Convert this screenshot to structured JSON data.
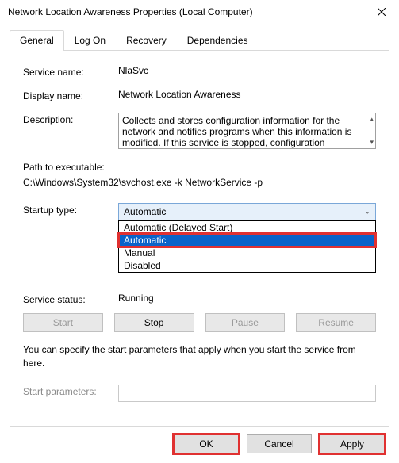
{
  "window": {
    "title": "Network Location Awareness Properties (Local Computer)"
  },
  "tabs": {
    "general": "General",
    "logon": "Log On",
    "recovery": "Recovery",
    "dependencies": "Dependencies"
  },
  "labels": {
    "service_name": "Service name:",
    "display_name": "Display name:",
    "description": "Description:",
    "path_to_exe": "Path to executable:",
    "startup_type": "Startup type:",
    "service_status": "Service status:",
    "start_parameters": "Start parameters:"
  },
  "values": {
    "service_name": "NlaSvc",
    "display_name": "Network Location Awareness",
    "description": "Collects and stores configuration information for the network and notifies programs when this information is modified. If this service is stopped, configuration",
    "path_to_exe": "C:\\Windows\\System32\\svchost.exe -k NetworkService -p",
    "startup_selected": "Automatic",
    "service_status": "Running",
    "hint": "You can specify the start parameters that apply when you start the service from here.",
    "start_parameters": ""
  },
  "startup_options": {
    "delayed": "Automatic (Delayed Start)",
    "automatic": "Automatic",
    "manual": "Manual",
    "disabled": "Disabled"
  },
  "buttons": {
    "start": "Start",
    "stop": "Stop",
    "pause": "Pause",
    "resume": "Resume",
    "ok": "OK",
    "cancel": "Cancel",
    "apply": "Apply"
  }
}
